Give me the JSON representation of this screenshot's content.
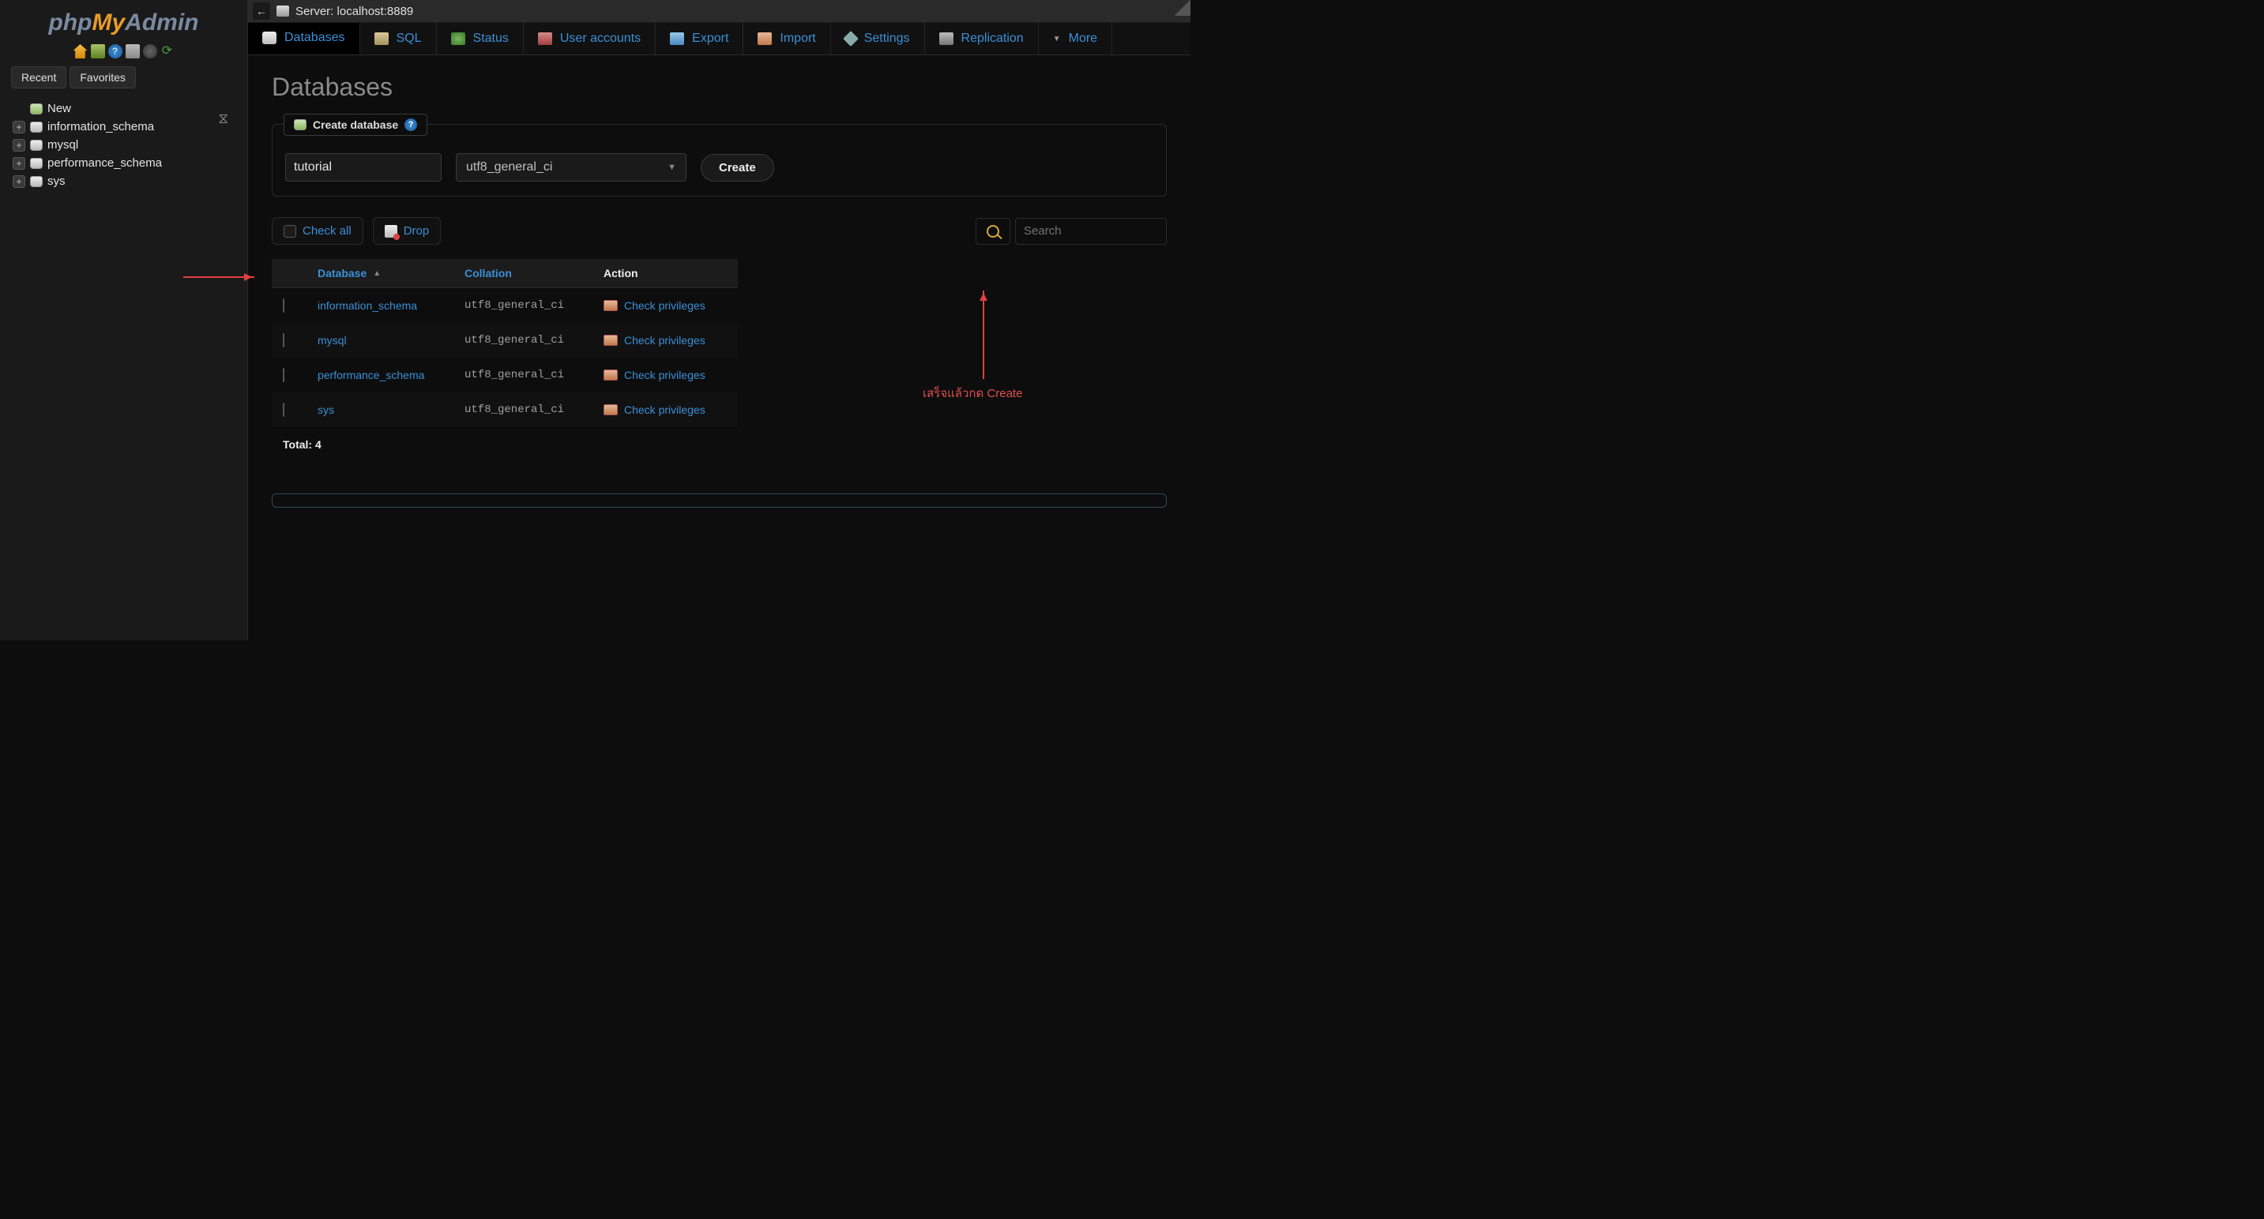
{
  "logo": {
    "part1": "php",
    "part2": "My",
    "part3": "Admin"
  },
  "sidebar": {
    "tabs": [
      "Recent",
      "Favorites"
    ],
    "new_label": "New",
    "items": [
      {
        "name": "information_schema"
      },
      {
        "name": "mysql"
      },
      {
        "name": "performance_schema"
      },
      {
        "name": "sys"
      }
    ]
  },
  "server_bar": {
    "label": "Server: localhost:8889"
  },
  "tabs": [
    {
      "label": "Databases",
      "icon": "ti-db",
      "active": true
    },
    {
      "label": "SQL",
      "icon": "ti-sql"
    },
    {
      "label": "Status",
      "icon": "ti-status"
    },
    {
      "label": "User accounts",
      "icon": "ti-users"
    },
    {
      "label": "Export",
      "icon": "ti-export"
    },
    {
      "label": "Import",
      "icon": "ti-import"
    },
    {
      "label": "Settings",
      "icon": "ti-settings"
    },
    {
      "label": "Replication",
      "icon": "ti-repl"
    },
    {
      "label": "More",
      "icon": "ti-more"
    }
  ],
  "page_title": "Databases",
  "create_panel": {
    "heading": "Create database",
    "name_value": "tutorial",
    "collation_value": "utf8_general_ci",
    "button": "Create"
  },
  "toolbar": {
    "check_all": "Check all",
    "drop": "Drop",
    "search_placeholder": "Search"
  },
  "table": {
    "headers": {
      "database": "Database",
      "collation": "Collation",
      "action": "Action"
    },
    "link_label": "Check privileges",
    "rows": [
      {
        "name": "information_schema",
        "collation": "utf8_general_ci"
      },
      {
        "name": "mysql",
        "collation": "utf8_general_ci"
      },
      {
        "name": "performance_schema",
        "collation": "utf8_general_ci"
      },
      {
        "name": "sys",
        "collation": "utf8_general_ci"
      }
    ],
    "total_label": "Total: 4"
  },
  "annotation": "เสร็จแล้วกด Create"
}
